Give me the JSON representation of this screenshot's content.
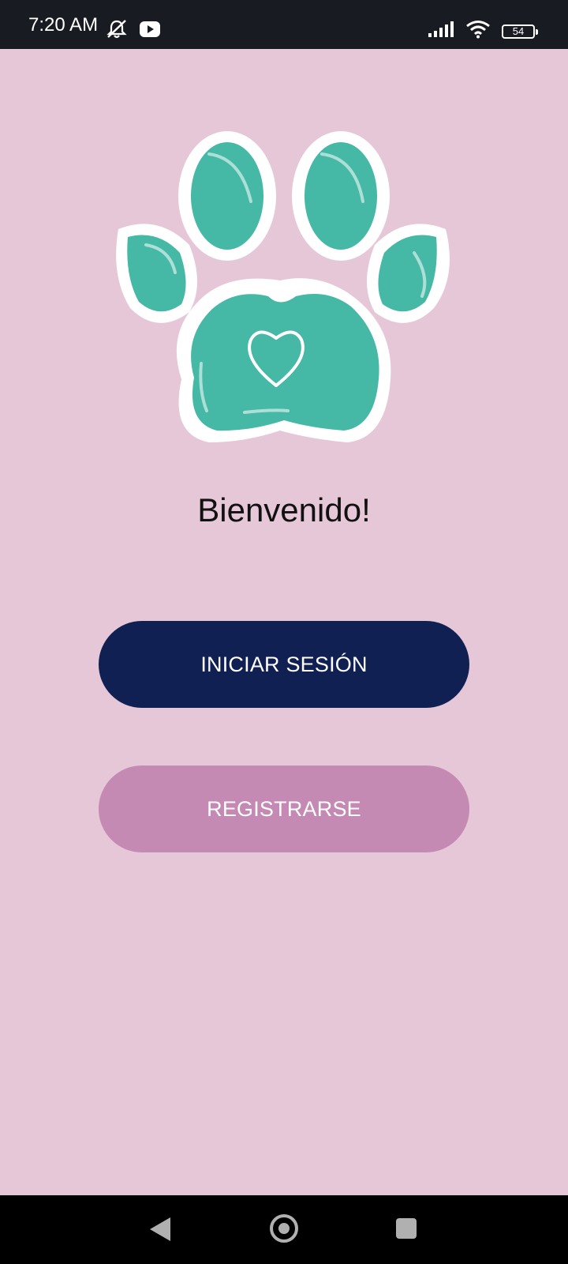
{
  "status_bar": {
    "time": "7:20 AM",
    "battery": "54",
    "icons": [
      "notifications-muted-icon",
      "youtube-icon",
      "signal-icon",
      "wifi-icon",
      "battery-icon"
    ]
  },
  "logo": {
    "icon": "paw-heart-icon",
    "colors": {
      "pad": "#45b8a6",
      "outline": "#ffffff"
    }
  },
  "welcome": {
    "title": "Bienvenido!"
  },
  "buttons": {
    "login_label": "INICIAR SESIÓN",
    "register_label": "REGISTRARSE"
  },
  "colors": {
    "background": "#e5c7d8",
    "login_button": "#102052",
    "register_button": "#c58ab3"
  },
  "nav_bar": {
    "icons": [
      "back-icon",
      "home-icon",
      "recent-apps-icon"
    ]
  }
}
